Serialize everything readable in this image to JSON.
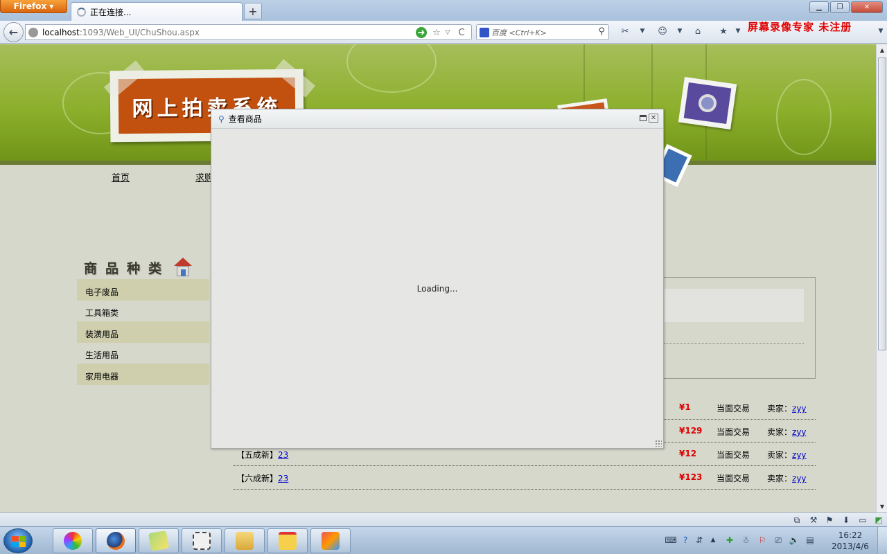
{
  "browser": {
    "menu_button": "Firefox",
    "tab_title": "正在连接...",
    "new_tab": "+",
    "url_host": "localhost",
    "url_path": ":1093/Web_UI/ChuShou.aspx",
    "search_placeholder": "百度 <Ctrl+K>",
    "back_arrow": "←",
    "reload": "C",
    "star": "☆",
    "dropdown": "▽"
  },
  "watermark": "屏幕录像专家 未注册",
  "site": {
    "logo_text": "网上拍卖系统",
    "nav": [
      {
        "label": "首页"
      },
      {
        "label": "求购"
      }
    ],
    "categories_title": "商品种类",
    "categories": [
      {
        "label": "电子废品"
      },
      {
        "label": "工具箱类"
      },
      {
        "label": "装潢用品"
      },
      {
        "label": "生活用品"
      },
      {
        "label": "家用电器"
      }
    ],
    "listings": [
      {
        "condition": "",
        "title": "",
        "price": "¥1",
        "trade": "当面交易",
        "seller_label": "卖家：",
        "seller": "zyy"
      },
      {
        "condition": "",
        "title": "",
        "price": "¥129",
        "trade": "当面交易",
        "seller_label": "卖家：",
        "seller": "zyy"
      },
      {
        "condition": "【五成新】",
        "title": "23",
        "price": "¥12",
        "trade": "当面交易",
        "seller_label": "卖家：",
        "seller": "zyy"
      },
      {
        "condition": "【六成新】",
        "title": "23",
        "price": "¥123",
        "trade": "当面交易",
        "seller_label": "卖家：",
        "seller": "zyy"
      }
    ]
  },
  "modal": {
    "title": "查看商品",
    "loading": "Loading..."
  },
  "taskbar": {
    "time": "16:22",
    "date": "2013/4/6"
  },
  "colors": {
    "banner_green": "#8caf2c",
    "logo_orange": "#c2500f",
    "price_red": "#dd0000",
    "link_blue": "#0000cc",
    "category_shade": "#cfcfae"
  }
}
